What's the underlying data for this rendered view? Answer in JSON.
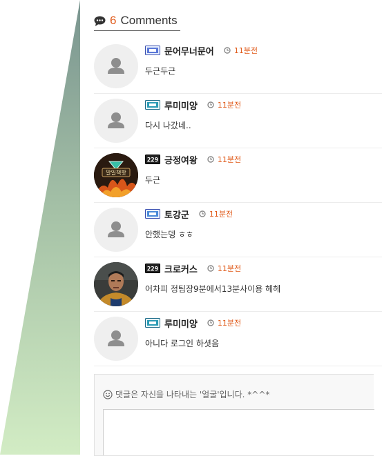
{
  "comments_header": {
    "count": "6",
    "label": "Comments"
  },
  "comments": [
    {
      "nickname": "문어무너문어",
      "level_icon": "level-badge-icon",
      "time": "11분전",
      "text": "두근두근",
      "avatar": "default-avatar"
    },
    {
      "nickname": "루미미양",
      "level_icon": "level-badge-icon",
      "time": "11분전",
      "text": "다시 나갔네..",
      "avatar": "default-avatar"
    },
    {
      "nickname": "긍정여왕",
      "level_icon": "level-badge-dark-icon",
      "time": "11분전",
      "text": "두근",
      "avatar": "photo-avatar-game",
      "avatar_caption": "말일책팟"
    },
    {
      "nickname": "토강군",
      "level_icon": "level-badge-icon",
      "time": "11분전",
      "text": "안했는뎅 ㅎㅎ",
      "avatar": "default-avatar"
    },
    {
      "nickname": "크로커스",
      "level_icon": "level-badge-dark-icon",
      "time": "11분전",
      "text": "어차피 정팀장9분에서13분사이용 헤헤",
      "avatar": "photo-avatar-person"
    },
    {
      "nickname": "루미미양",
      "level_icon": "level-badge-icon",
      "time": "11분전",
      "text": "아니다 로그인 하셧음",
      "avatar": "default-avatar"
    }
  ],
  "comment_form": {
    "hint": "댓글은 자신을 나타내는 '얼굴'입니다. *^^*"
  },
  "colors": {
    "accent": "#e05a1a",
    "background_wedge_top": "#7f9a96",
    "background_wedge_bottom": "#cfe9bf"
  }
}
